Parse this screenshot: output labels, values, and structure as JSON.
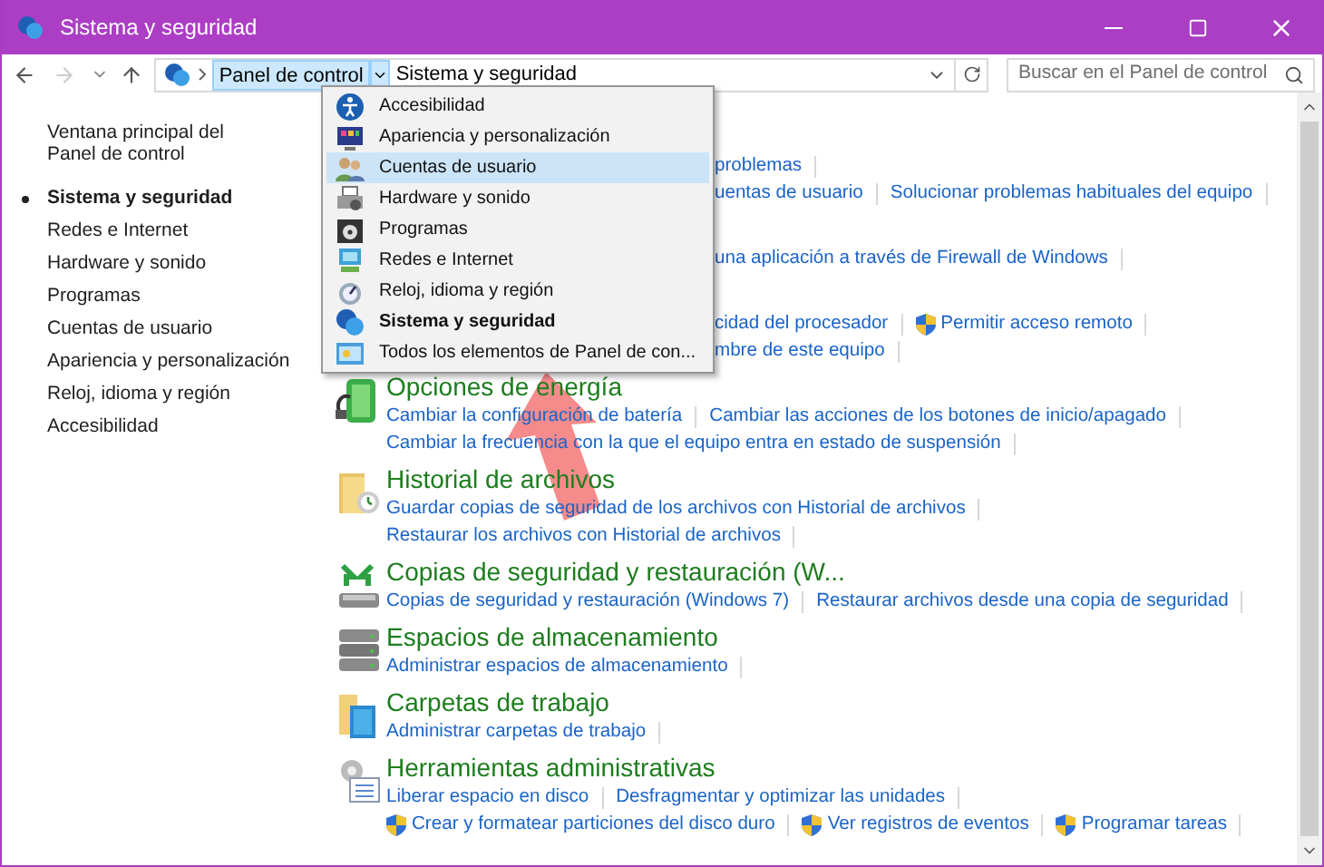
{
  "window": {
    "title": "Sistema y seguridad"
  },
  "address": {
    "breadcrumbs": [
      {
        "label": "Panel de control",
        "selected": true
      },
      {
        "label": "Sistema y seguridad",
        "selected": false
      }
    ],
    "forward_disabled": true
  },
  "search": {
    "placeholder": "Buscar en el Panel de control"
  },
  "sidebar": {
    "home": "Ventana principal del Panel de control",
    "items": [
      {
        "label": "Sistema y seguridad",
        "selected": true
      },
      {
        "label": "Redes e Internet",
        "selected": false
      },
      {
        "label": "Hardware y sonido",
        "selected": false
      },
      {
        "label": "Programas",
        "selected": false
      },
      {
        "label": "Cuentas de usuario",
        "selected": false
      },
      {
        "label": "Apariencia y personalización",
        "selected": false
      },
      {
        "label": "Reloj, idioma y región",
        "selected": false
      },
      {
        "label": "Accesibilidad",
        "selected": false
      }
    ]
  },
  "menu": {
    "items": [
      {
        "label": "Accesibilidad",
        "selected": false,
        "current": false
      },
      {
        "label": "Apariencia y personalización",
        "selected": false,
        "current": false
      },
      {
        "label": "Cuentas de usuario",
        "selected": true,
        "current": false
      },
      {
        "label": "Hardware y sonido",
        "selected": false,
        "current": false
      },
      {
        "label": "Programas",
        "selected": false,
        "current": false
      },
      {
        "label": "Redes e Internet",
        "selected": false,
        "current": false
      },
      {
        "label": "Reloj, idioma y región",
        "selected": false,
        "current": false
      },
      {
        "label": "Sistema y seguridad",
        "selected": false,
        "current": true
      },
      {
        "label": "Todos los elementos de Panel de con...",
        "selected": false,
        "current": false
      }
    ]
  },
  "sections": [
    {
      "kind": "covered",
      "lines": [
        [
          {
            "text": "problemas",
            "shield": false
          }
        ],
        [
          {
            "text": "uentas de usuario",
            "shield": false
          },
          {
            "text": "Solucionar problemas habituales del equipo",
            "shield": false
          }
        ]
      ]
    },
    {
      "kind": "covered",
      "lines": [
        [
          {
            "text": "una aplicación a través de Firewall de Windows",
            "shield": false
          }
        ]
      ]
    },
    {
      "kind": "covered",
      "lines": [
        [
          {
            "text": "cidad del procesador",
            "shield": false
          },
          {
            "text": "Permitir acceso remoto",
            "shield": true
          }
        ],
        [
          {
            "text": "mbre de este equipo",
            "shield": false
          }
        ]
      ]
    },
    {
      "kind": "full",
      "title": "Opciones de energía",
      "lines": [
        [
          {
            "text": "Cambiar la configuración de batería",
            "shield": false
          },
          {
            "text": "Cambiar las acciones de los botones de inicio/apagado",
            "shield": false
          }
        ],
        [
          {
            "text": "Cambiar la frecuencia con la que el equipo entra en estado de suspensión",
            "shield": false
          }
        ]
      ]
    },
    {
      "kind": "full",
      "title": "Historial de archivos",
      "lines": [
        [
          {
            "text": "Guardar copias de seguridad de los archivos con Historial de archivos",
            "shield": false
          }
        ],
        [
          {
            "text": "Restaurar los archivos con Historial de archivos",
            "shield": false
          }
        ]
      ]
    },
    {
      "kind": "full",
      "title": "Copias de seguridad y restauración (W...",
      "lines": [
        [
          {
            "text": "Copias de seguridad y restauración (Windows 7)",
            "shield": false
          },
          {
            "text": "Restaurar archivos desde una copia de seguridad",
            "shield": false
          }
        ]
      ]
    },
    {
      "kind": "full",
      "title": "Espacios de almacenamiento",
      "lines": [
        [
          {
            "text": "Administrar espacios de almacenamiento",
            "shield": false
          }
        ]
      ]
    },
    {
      "kind": "full",
      "title": "Carpetas de trabajo",
      "lines": [
        [
          {
            "text": "Administrar carpetas de trabajo",
            "shield": false
          }
        ]
      ]
    },
    {
      "kind": "full",
      "title": "Herramientas administrativas",
      "lines": [
        [
          {
            "text": "Liberar espacio en disco",
            "shield": false
          },
          {
            "text": "Desfragmentar y optimizar las unidades",
            "shield": false
          }
        ],
        [
          {
            "text": "Crear y formatear particiones del disco duro",
            "shield": true
          },
          {
            "text": "Ver registros de eventos",
            "shield": true
          },
          {
            "text": "Programar tareas",
            "shield": true
          }
        ]
      ]
    }
  ]
}
